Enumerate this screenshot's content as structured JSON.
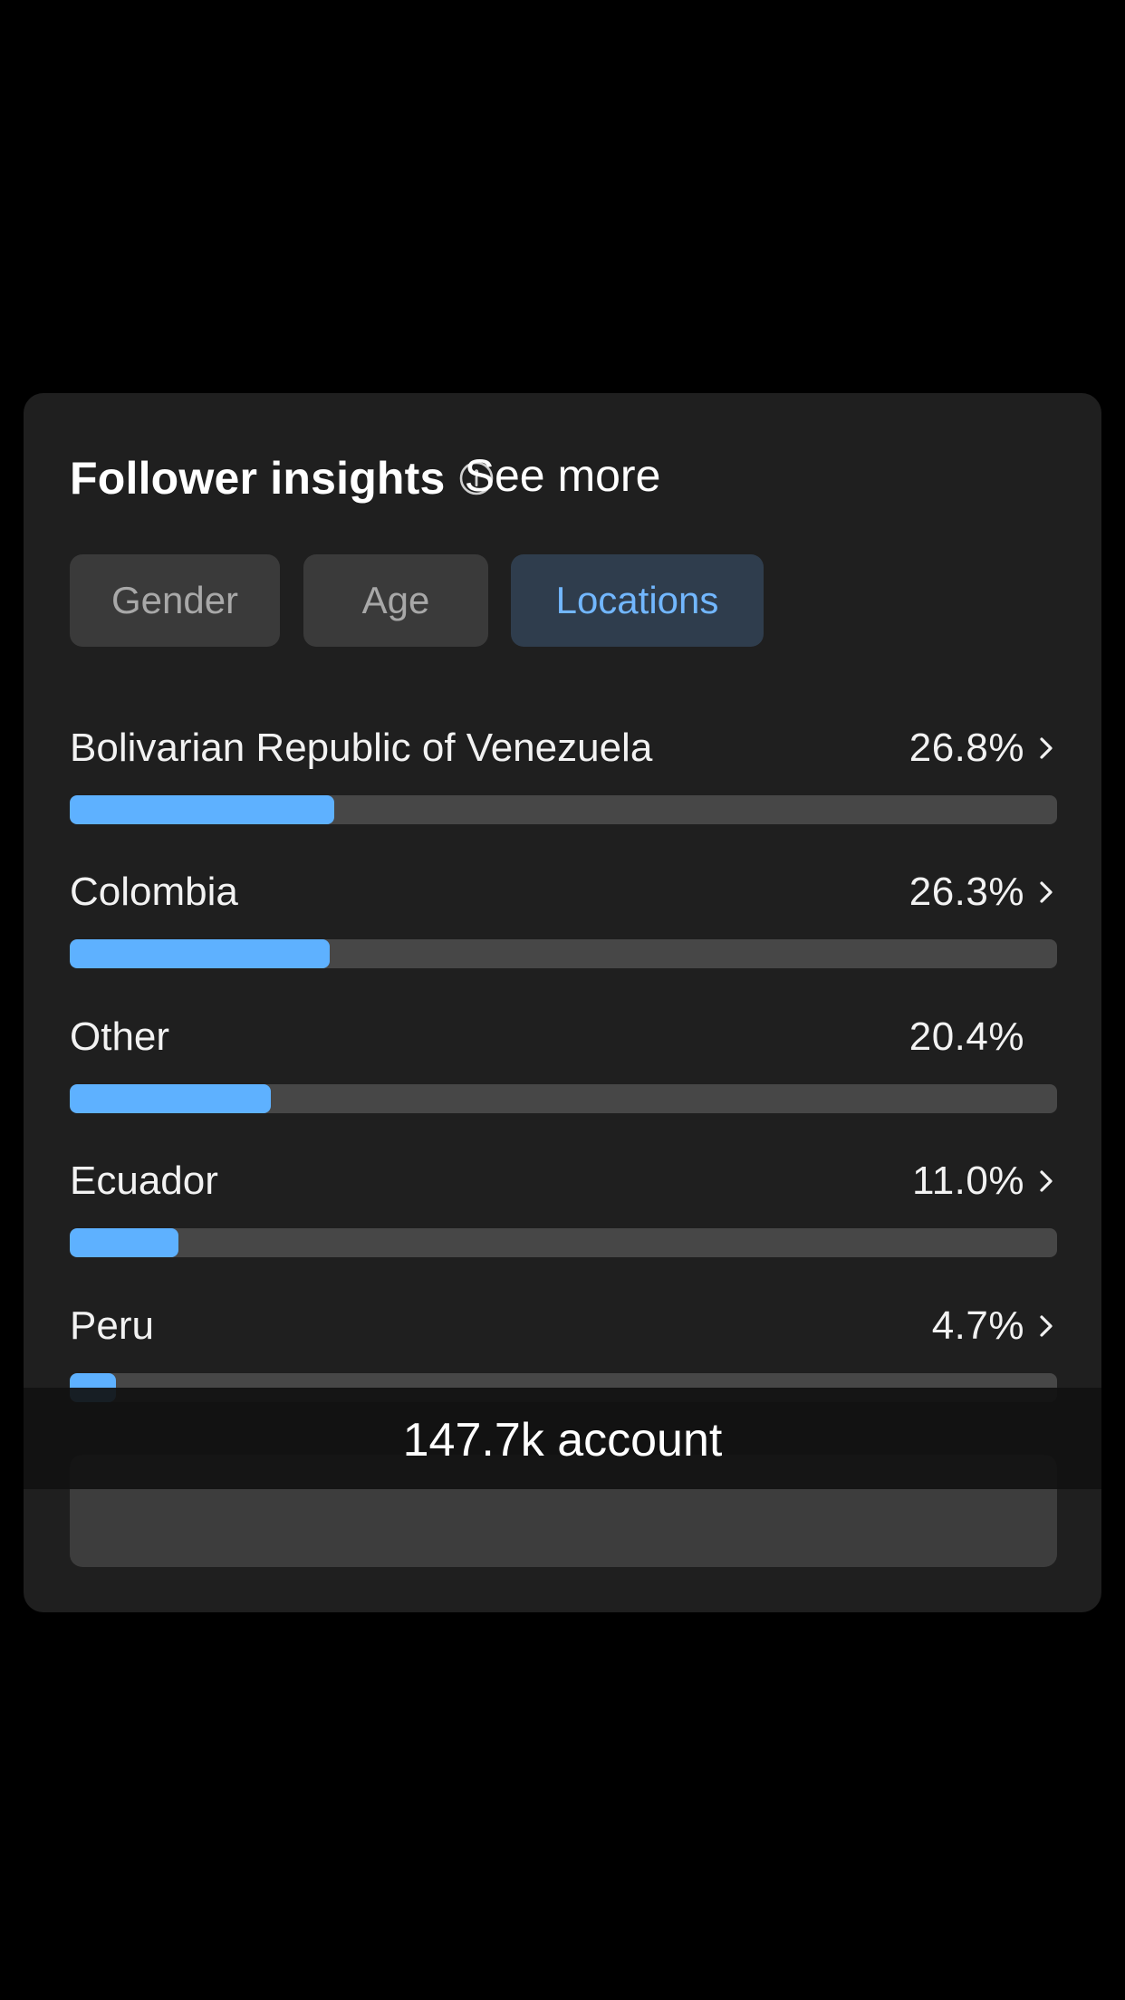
{
  "card": {
    "title": "Follower insights",
    "info_icon": "info-circle-icon"
  },
  "tabs": [
    {
      "label": "Gender",
      "active": false
    },
    {
      "label": "Age",
      "active": false
    },
    {
      "label": "Locations",
      "active": true
    }
  ],
  "locations": [
    {
      "name": "Bolivarian Republic of Venezuela",
      "percent_label": "26.8%",
      "share": 0.268,
      "has_chevron": true
    },
    {
      "name": "Colombia",
      "percent_label": "26.3%",
      "share": 0.263,
      "has_chevron": true
    },
    {
      "name": "Other",
      "percent_label": "20.4%",
      "share": 0.204,
      "has_chevron": false
    },
    {
      "name": "Ecuador",
      "percent_label": "11.0%",
      "share": 0.11,
      "has_chevron": true
    },
    {
      "name": "Peru",
      "percent_label": "4.7%",
      "share": 0.047,
      "has_chevron": true
    }
  ],
  "toast": {
    "text": "147.7k account"
  },
  "see_more": {
    "label": "See more"
  },
  "colors": {
    "background": "#000000",
    "card": "#1f1f1f",
    "bar_fill": "#5eb1ff",
    "bar_track": "#474747",
    "tab_active_bg": "#2f3d4d",
    "tab_active_text": "#72b7ff",
    "tab_inactive_bg": "#3a3a3a",
    "tab_inactive_text": "#a8a8a8"
  }
}
